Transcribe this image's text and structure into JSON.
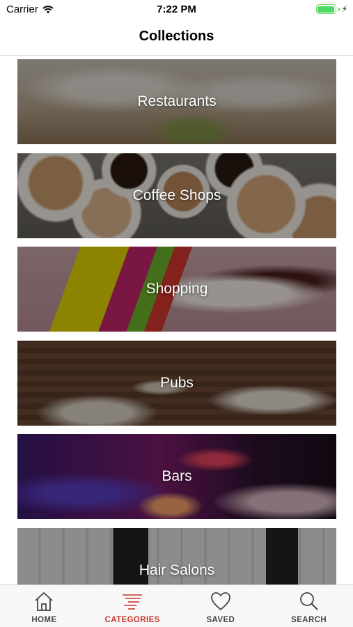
{
  "status_bar": {
    "carrier": "Carrier",
    "time": "7:22 PM",
    "battery_level": 1.0,
    "charging": true
  },
  "nav": {
    "title": "Collections"
  },
  "collections": [
    {
      "label": "Restaurants"
    },
    {
      "label": "Coffee Shops"
    },
    {
      "label": "Shopping"
    },
    {
      "label": "Pubs"
    },
    {
      "label": "Bars"
    },
    {
      "label": "Hair Salons"
    }
  ],
  "tabs": [
    {
      "label": "HOME",
      "icon": "home-icon",
      "active": false
    },
    {
      "label": "CATEGORIES",
      "icon": "categories-icon",
      "active": true
    },
    {
      "label": "SAVED",
      "icon": "heart-icon",
      "active": false
    },
    {
      "label": "SEARCH",
      "icon": "search-icon",
      "active": false
    }
  ],
  "colors": {
    "active_tab": "#c9352d",
    "inactive_tab": "#444444",
    "battery": "#4cd964"
  }
}
